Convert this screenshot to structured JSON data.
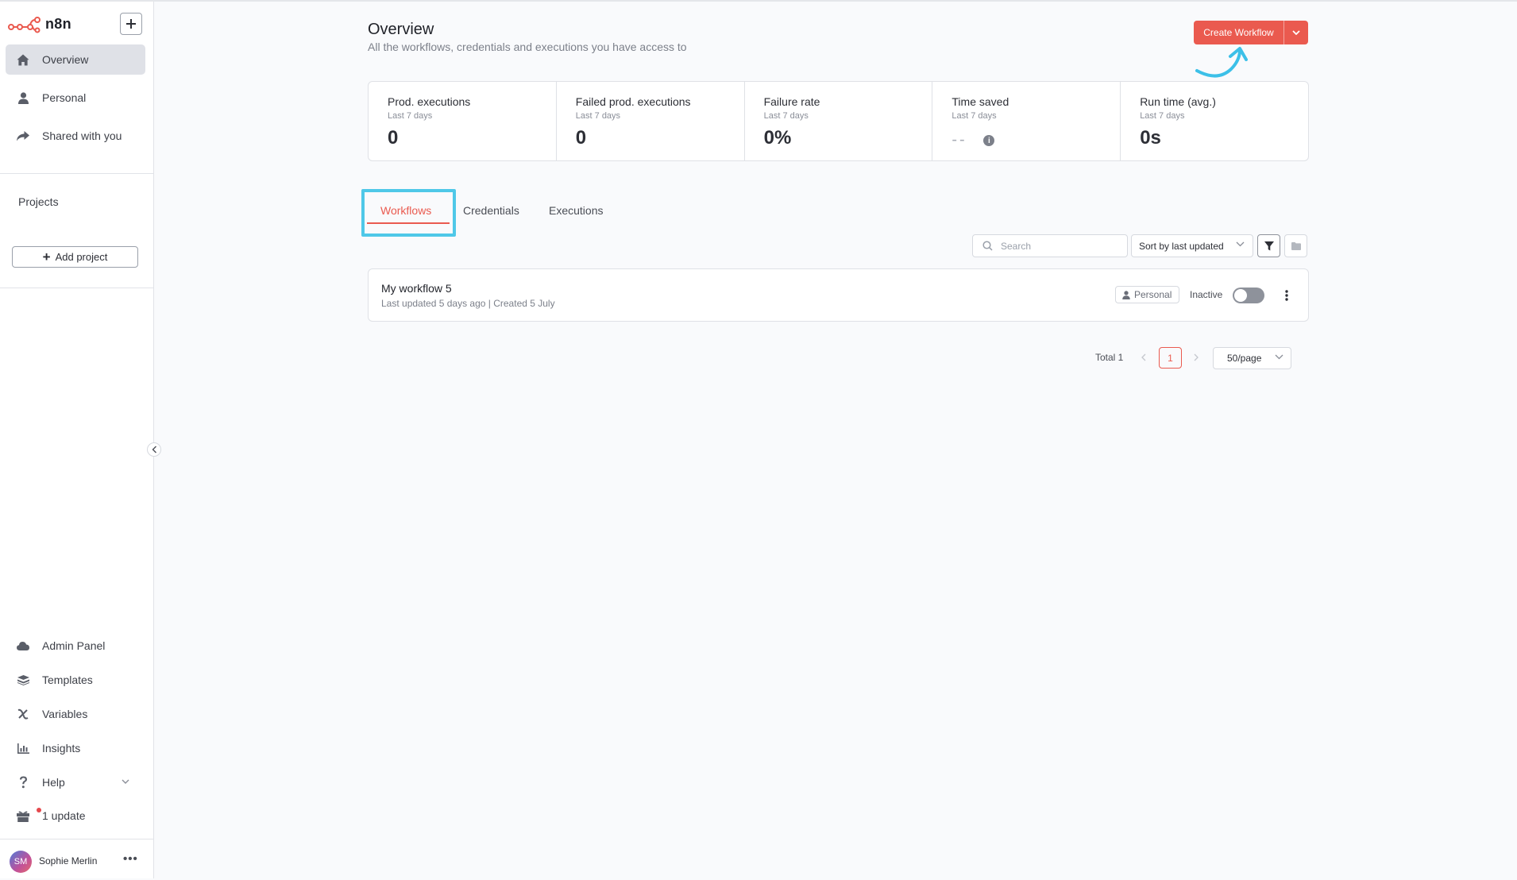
{
  "app": {
    "logo_text": "n8n"
  },
  "sidebar": {
    "nav": [
      {
        "label": "Overview",
        "icon": "home-icon",
        "active": true
      },
      {
        "label": "Personal",
        "icon": "user-icon"
      },
      {
        "label": "Shared with you",
        "icon": "share-icon"
      }
    ],
    "projects_title": "Projects",
    "add_project_label": "Add project",
    "bottom": [
      {
        "label": "Admin Panel",
        "icon": "cloud-icon"
      },
      {
        "label": "Templates",
        "icon": "templates-icon"
      },
      {
        "label": "Variables",
        "icon": "variables-icon"
      },
      {
        "label": "Insights",
        "icon": "chart-icon"
      },
      {
        "label": "Help",
        "icon": "help-icon"
      },
      {
        "label": "1 update",
        "icon": "gift-icon"
      }
    ],
    "user": {
      "initials": "SM",
      "name": "Sophie Merlin"
    }
  },
  "header": {
    "title": "Overview",
    "subtitle": "All the workflows, credentials and executions you have access to",
    "create_button": "Create Workflow"
  },
  "stats": [
    {
      "label": "Prod. executions",
      "period": "Last 7 days",
      "value": "0"
    },
    {
      "label": "Failed prod. executions",
      "period": "Last 7 days",
      "value": "0"
    },
    {
      "label": "Failure rate",
      "period": "Last 7 days",
      "value": "0%"
    },
    {
      "label": "Time saved",
      "period": "Last 7 days",
      "value": "--",
      "info": "i"
    },
    {
      "label": "Run time (avg.)",
      "period": "Last 7 days",
      "value": "0s"
    }
  ],
  "tabs": [
    {
      "label": "Workflows",
      "active": true
    },
    {
      "label": "Credentials"
    },
    {
      "label": "Executions"
    }
  ],
  "toolbar": {
    "search_placeholder": "Search",
    "sort_label": "Sort by last updated"
  },
  "workflows": [
    {
      "name": "My workflow 5",
      "meta": "Last updated 5 days ago | Created 5 July",
      "owner_badge": "Personal",
      "status": "Inactive",
      "active": false
    }
  ],
  "pagination": {
    "total_label": "Total 1",
    "current_page": "1",
    "per_page": "50/page"
  },
  "colors": {
    "accent": "#ea5a4f",
    "highlight": "#4fc8e8"
  }
}
